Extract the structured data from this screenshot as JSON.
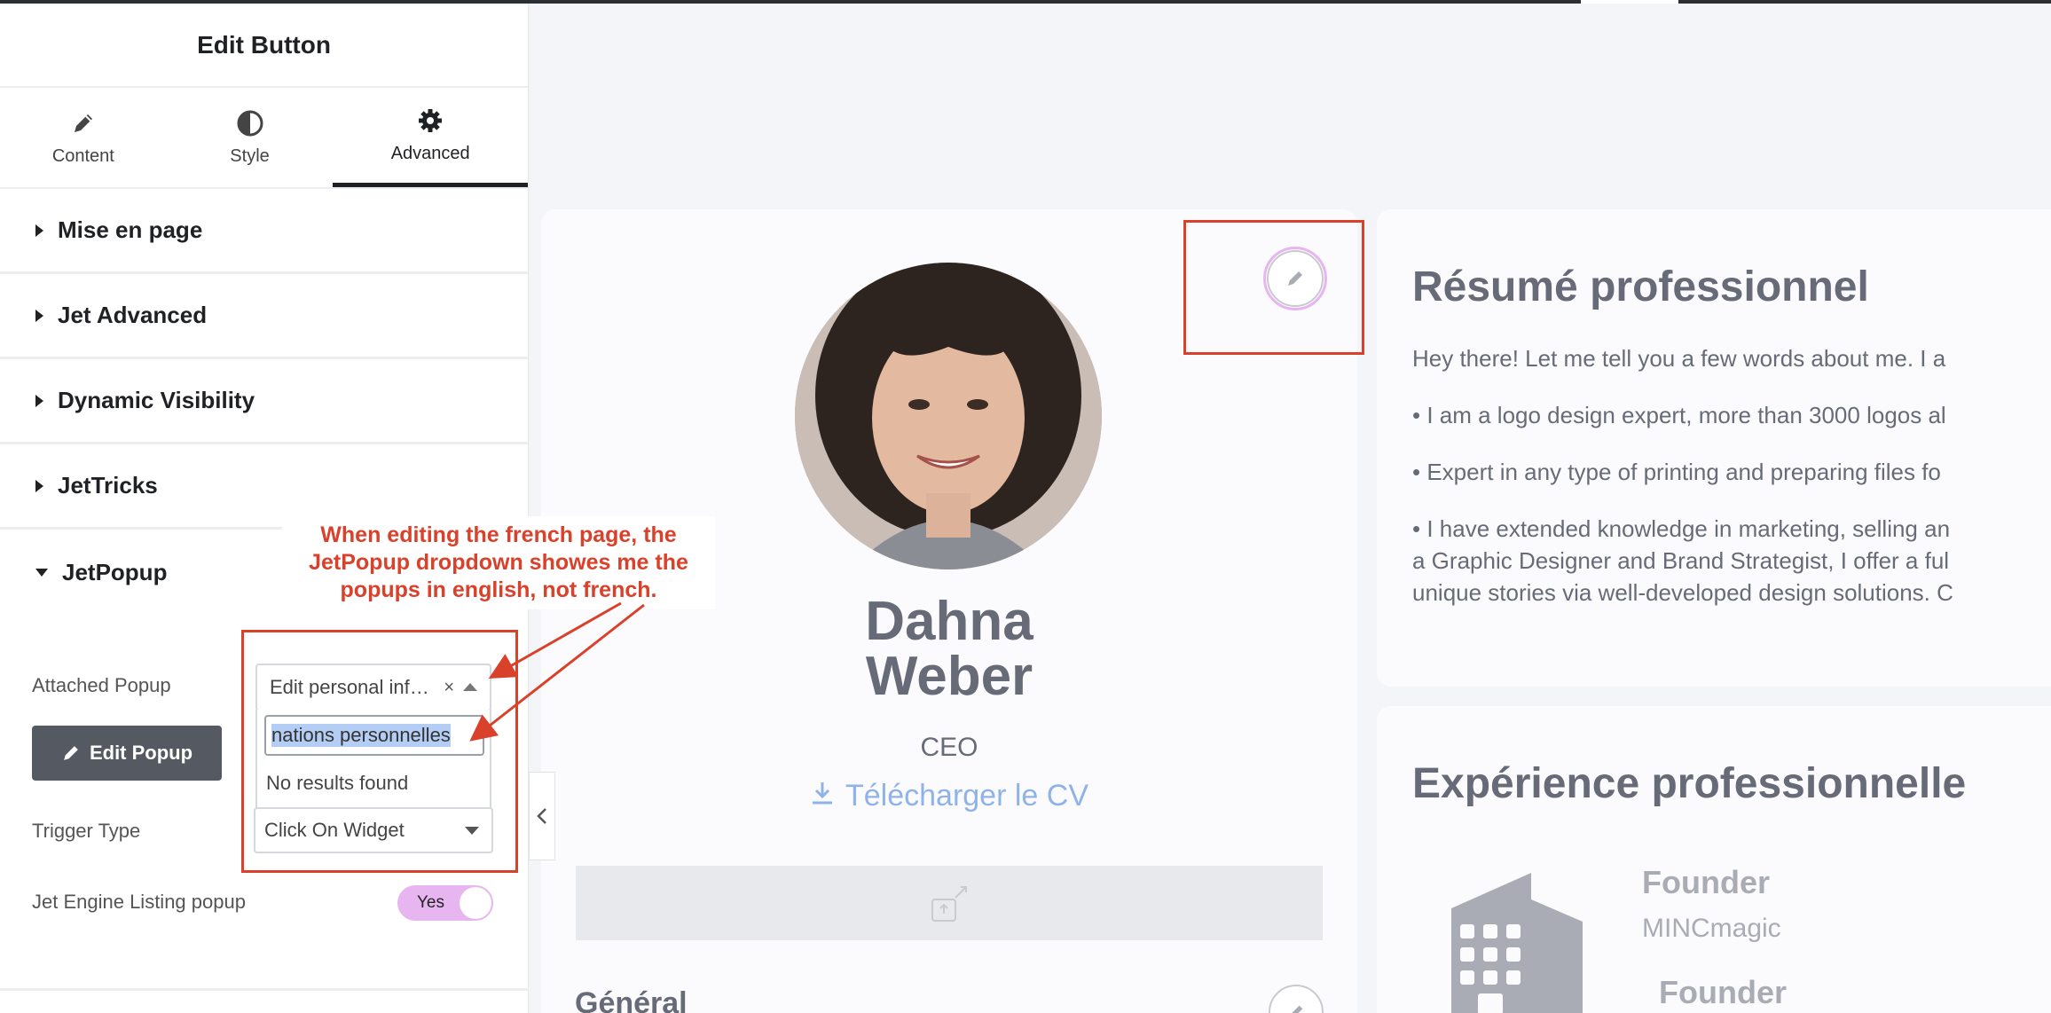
{
  "panel": {
    "title": "Edit Button",
    "tabs": [
      {
        "label": "Content",
        "icon": "pencil-icon"
      },
      {
        "label": "Style",
        "icon": "half-circle-icon"
      },
      {
        "label": "Advanced",
        "icon": "gear-icon",
        "active": true
      }
    ],
    "sections": [
      {
        "label": "Mise en page",
        "expanded": false
      },
      {
        "label": "Jet Advanced",
        "expanded": false
      },
      {
        "label": "Dynamic Visibility",
        "expanded": false
      },
      {
        "label": "JetTricks",
        "expanded": false
      },
      {
        "label": "JetPopup",
        "expanded": true
      }
    ],
    "jetpopup": {
      "attached_popup_label": "Attached Popup",
      "attached_popup_value": "Edit personal inf…",
      "clear_symbol": "×",
      "search_value": "nations personnelles",
      "no_results": "No results found",
      "edit_popup_button": "Edit Popup",
      "trigger_type_label": "Trigger Type",
      "trigger_type_value": "Click On Widget",
      "listing_popup_label": "Jet Engine Listing popup",
      "listing_popup_toggle": "Yes"
    }
  },
  "annotation": {
    "text": "When editing the french page, the JetPopup dropdown showes me the popups in english, not french.",
    "color": "#d9412b"
  },
  "profile": {
    "name_line1": "Dahna",
    "name_line2": "Weber",
    "role": "CEO",
    "download_label": "Télécharger le CV",
    "general_heading": "Général"
  },
  "summary": {
    "heading": "Résumé professionnel",
    "lines": [
      "Hey there! Let me tell you a few words about me. I a",
      "• I am a logo design expert, more than 3000 logos al",
      "• Expert in any type of printing and preparing files fo",
      "• I have extended knowledge in marketing, selling an",
      "a Graphic Designer and Brand Strategist, I offer a ful",
      "unique stories via well-developed design solutions. C"
    ]
  },
  "experience": {
    "heading": "Expérience professionnelle",
    "job1_title": "Founder",
    "job1_company": "MINCmagic",
    "job2_title": "Founder"
  },
  "colors": {
    "accent_red": "#d9412b",
    "toggle_pink": "#e7b6f0",
    "link_blue": "#8fb3e8",
    "text_grey": "#676b78"
  }
}
